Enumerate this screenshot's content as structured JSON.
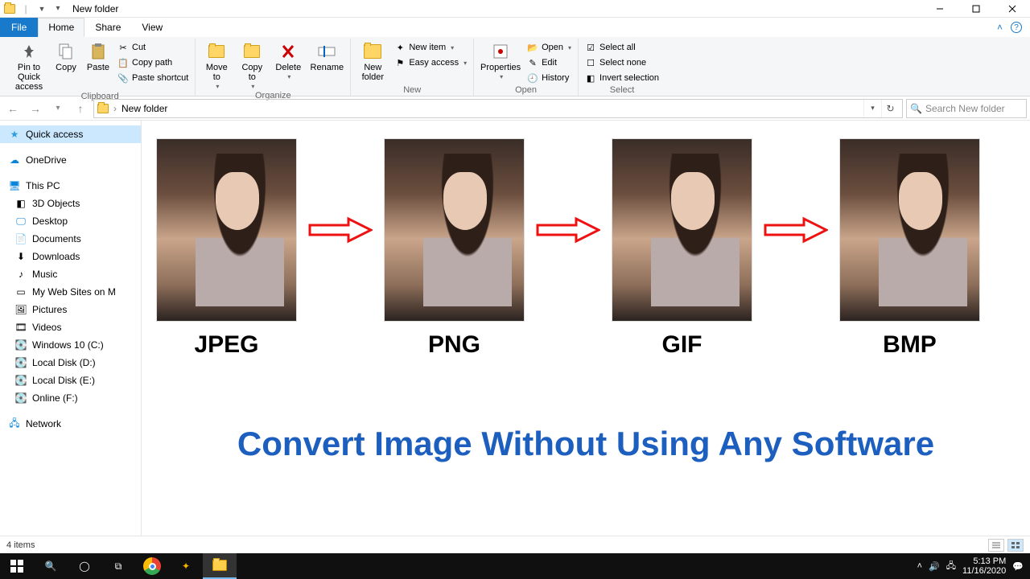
{
  "window": {
    "title": "New folder"
  },
  "tabs": {
    "file": "File",
    "home": "Home",
    "share": "Share",
    "view": "View"
  },
  "ribbon": {
    "clipboard": {
      "label": "Clipboard",
      "pin": "Pin to Quick\naccess",
      "copy": "Copy",
      "paste": "Paste",
      "cut": "Cut",
      "copypath": "Copy path",
      "pasteshortcut": "Paste shortcut"
    },
    "organize": {
      "label": "Organize",
      "moveto": "Move\nto",
      "copyto": "Copy\nto",
      "delete": "Delete",
      "rename": "Rename"
    },
    "new": {
      "label": "New",
      "newfolder": "New\nfolder",
      "newitem": "New item",
      "easyaccess": "Easy access"
    },
    "open": {
      "label": "Open",
      "properties": "Properties",
      "open": "Open",
      "edit": "Edit",
      "history": "History"
    },
    "select": {
      "label": "Select",
      "all": "Select all",
      "none": "Select none",
      "invert": "Invert selection"
    }
  },
  "address": {
    "folder": "New folder",
    "search_placeholder": "Search New folder"
  },
  "sidebar": {
    "quick": "Quick access",
    "onedrive": "OneDrive",
    "thispc": "This PC",
    "items": [
      "3D Objects",
      "Desktop",
      "Documents",
      "Downloads",
      "Music",
      "My Web Sites on M",
      "Pictures",
      "Videos",
      "Windows 10 (C:)",
      "Local Disk (D:)",
      "Local Disk (E:)",
      "Online (F:)"
    ],
    "network": "Network"
  },
  "content": {
    "formats": [
      "JPEG",
      "PNG",
      "GIF",
      "BMP"
    ],
    "tagline": "Convert Image Without Using Any Software"
  },
  "status": {
    "count": "4 items"
  },
  "taskbar": {
    "time": "5:13 PM",
    "date": "11/16/2020"
  }
}
